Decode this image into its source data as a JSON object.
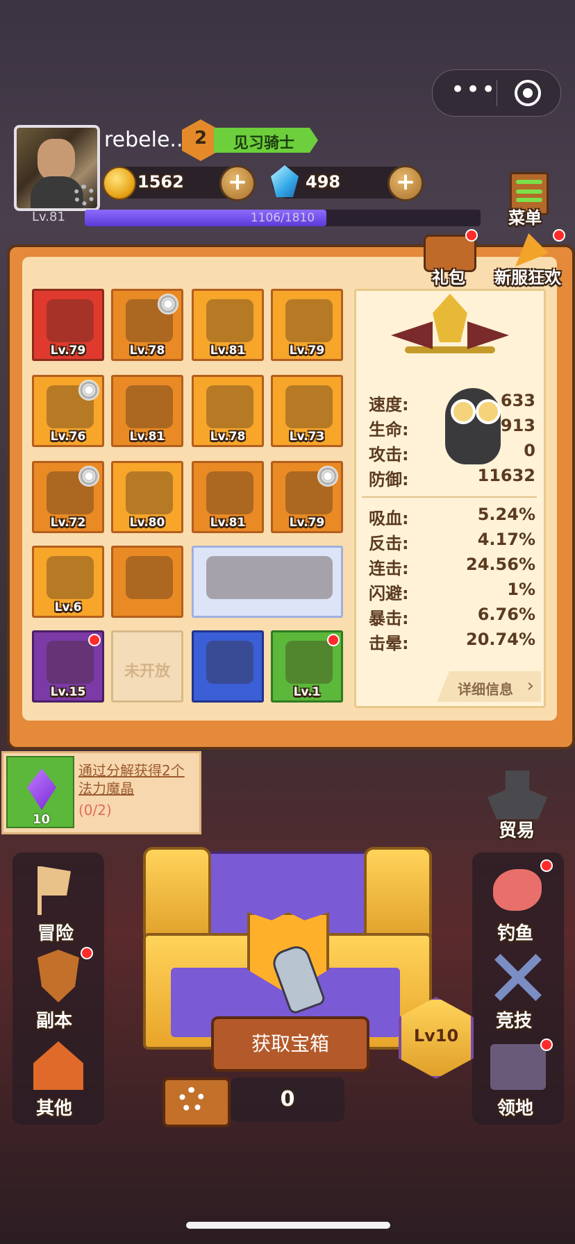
{
  "player": {
    "name": "rebele..",
    "rank_number": "2",
    "rank_title": "见习骑士",
    "level": "Lv.81",
    "xp": "1106/1810",
    "xp_fraction": 0.61
  },
  "resources": {
    "gold": "1562",
    "gems": "498"
  },
  "top_menu": {
    "menu_label": "菜单",
    "gift_label": "礼包",
    "event_label": "新服狂欢"
  },
  "equipment": [
    {
      "name": "gauntlet-icon",
      "lv": "Lv.79"
    },
    {
      "name": "helmet-icon",
      "lv": "Lv.78"
    },
    {
      "name": "cape-icon",
      "lv": "Lv.81"
    },
    {
      "name": "shoulder-armor-icon",
      "lv": "Lv.79"
    },
    {
      "name": "chest-armor-icon",
      "lv": "Lv.76"
    },
    {
      "name": "glove-icon",
      "lv": "Lv.81"
    },
    {
      "name": "belt-icon",
      "lv": "Lv.78"
    },
    {
      "name": "leg-armor-icon",
      "lv": "Lv.73"
    },
    {
      "name": "sword-icon",
      "lv": "Lv.72"
    },
    {
      "name": "ring-icon",
      "lv": "Lv.80"
    },
    {
      "name": "boots-icon",
      "lv": "Lv.81"
    },
    {
      "name": "mask-icon",
      "lv": "Lv.79"
    },
    {
      "name": "wing-armor-icon",
      "lv": "Lv.6"
    },
    {
      "name": "fish-icon",
      "lv": ""
    },
    {
      "name": "bat-wings-icon",
      "lv": ""
    },
    {
      "name": "golem-pet-icon",
      "lv": "Lv.15"
    },
    {
      "name": "locked-slot",
      "lv": "未开放"
    },
    {
      "name": "amulet-icon",
      "lv": ""
    },
    {
      "name": "potion-icon",
      "lv": "Lv.1"
    }
  ],
  "stats": {
    "speed": {
      "label": "速度:",
      "value": "633"
    },
    "hp": {
      "label": "生命:",
      "value": "913"
    },
    "atk": {
      "label": "攻击:",
      "value": "0"
    },
    "def": {
      "label": "防御:",
      "value": "11632"
    },
    "lifesteal": {
      "label": "吸血:",
      "value": "5.24%"
    },
    "counter": {
      "label": "反击:",
      "value": "4.17%"
    },
    "combo": {
      "label": "连击:",
      "value": "24.56%"
    },
    "dodge": {
      "label": "闪避:",
      "value": "1%"
    },
    "crit": {
      "label": "暴击:",
      "value": "6.76%"
    },
    "stun": {
      "label": "击晕:",
      "value": "20.74%"
    },
    "detail": "详细信息"
  },
  "quest": {
    "text": "通过分解获得2个法力魔晶",
    "progress": "(0/2)",
    "count": "10"
  },
  "left_nav": {
    "adventure": "冒险",
    "dungeon": "副本",
    "other": "其他"
  },
  "right_nav": {
    "trade": "贸易",
    "fishing": "钓鱼",
    "arena": "竞技",
    "territory": "领地"
  },
  "chest": {
    "button": "获取宝箱",
    "count": "0",
    "level": "Lv10"
  }
}
